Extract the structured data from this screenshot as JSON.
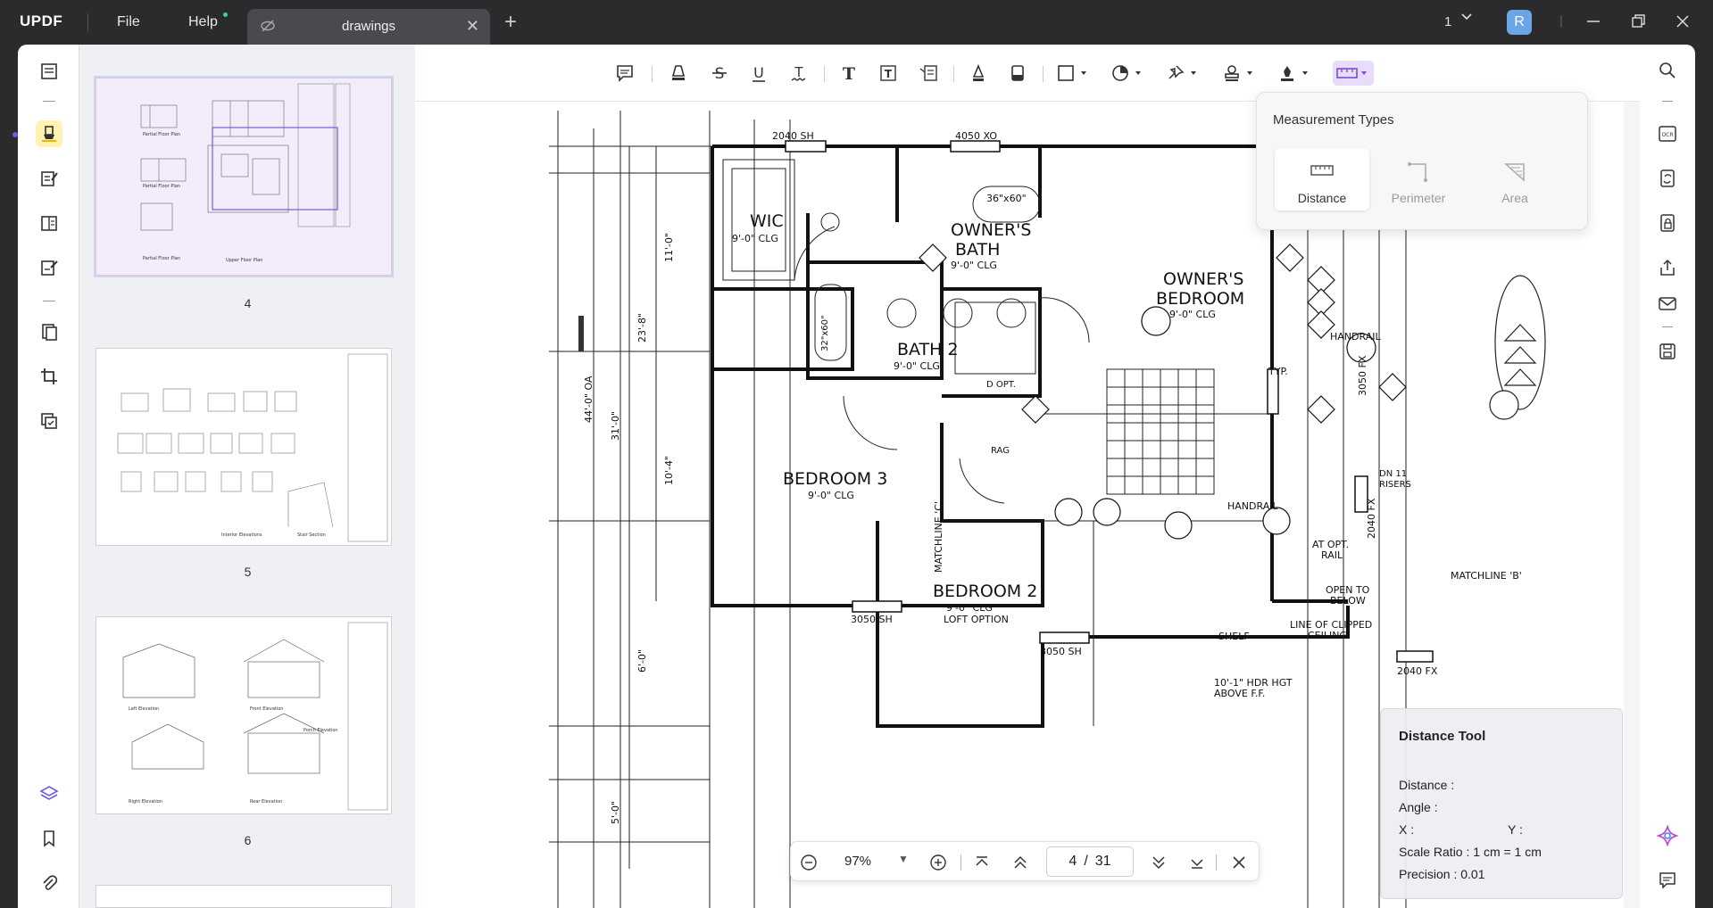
{
  "app": {
    "logo_prefix": "UPDF",
    "menu": {
      "file": "File",
      "help": "Help"
    },
    "tab_title": "drawings",
    "window_count": "1",
    "avatar_letter": "R"
  },
  "thumbnails": [
    {
      "page": "4",
      "selected": true,
      "captions": [
        "Partial Floor Plan",
        "Partial Floor Plan",
        "Partial Floor Plan",
        "Upper Floor Plan"
      ]
    },
    {
      "page": "5",
      "selected": false,
      "captions": [
        "Interior Elevations",
        "Stair Section"
      ]
    },
    {
      "page": "6",
      "selected": false,
      "captions": [
        "Left Elevation",
        "Front Elevation",
        "Porch Elevation",
        "Right Elevation",
        "Rear Elevation"
      ]
    }
  ],
  "measurement_popup": {
    "title": "Measurement Types",
    "types": [
      {
        "label": "Distance",
        "active": true
      },
      {
        "label": "Perimeter",
        "active": false
      },
      {
        "label": "Area",
        "active": false
      }
    ]
  },
  "distance_tool": {
    "title": "Distance Tool",
    "distance_label": "Distance :",
    "angle_label": "Angle :",
    "x_label": "X :",
    "y_label": "Y :",
    "scale_ratio": "Scale Ratio : 1 cm = 1 cm",
    "precision": "Precision : 0.01"
  },
  "navigation": {
    "zoom": "97%",
    "current_page": "4",
    "separator": "/",
    "total_pages": "31"
  },
  "drawing": {
    "rooms": {
      "owners_bedroom": [
        "OWNER'S",
        "BEDROOM",
        "9'-0\" CLG"
      ],
      "owners_bath": [
        "OWNER'S",
        "BATH",
        "9'-0\" CLG"
      ],
      "wic": [
        "WIC",
        "9'-0\" CLG"
      ],
      "bath2": [
        "BATH 2",
        "9'-0\" CLG"
      ],
      "bedroom3": [
        "BEDROOM 3",
        "9'-0\" CLG"
      ],
      "bedroom2": [
        "BEDROOM 2",
        "9'-0\" CLG",
        "LOFT OPTION"
      ]
    },
    "labels": {
      "window_top1": "2040 SH",
      "window_top2": "4050 XO",
      "window_bottom1": "3050 SH",
      "window_bottom2": "3050 SH",
      "window_right": "2040 FX",
      "window_fx": "3050 FX",
      "window_fx2": "2040 FX",
      "handrail": "HANDRAIL",
      "handrail2": "HANDRAIL",
      "at_opt_rail": [
        "AT OPT.",
        "RAIL"
      ],
      "open_to_below": [
        "OPEN TO",
        "BELOW"
      ],
      "clipped_ceiling": [
        "LINE OF CLIPPED",
        "CEILING"
      ],
      "shelf": "SHELF",
      "hdr": [
        "10'-1\" HDR HGT",
        "ABOVE F.F."
      ],
      "matchline_b": "MATCHLINE 'B'",
      "matchline_c": "MATCHLINE 'C'",
      "typ": "TYP.",
      "rag": "RAG",
      "dn": [
        "DN 11",
        "RISERS"
      ],
      "tub": "32\"x60\"",
      "shower": "36\"x60\"",
      "d_opt": "D OPT.",
      "dim_overall": "44'-0\" OA",
      "dim_31": "31'-0\"",
      "dim_23": "23'-8\"",
      "dim_11": "11'-0\"",
      "dim_10": "10'-4\"",
      "dim_6": "6'-0\"",
      "dim_5": "5'-0\""
    }
  }
}
